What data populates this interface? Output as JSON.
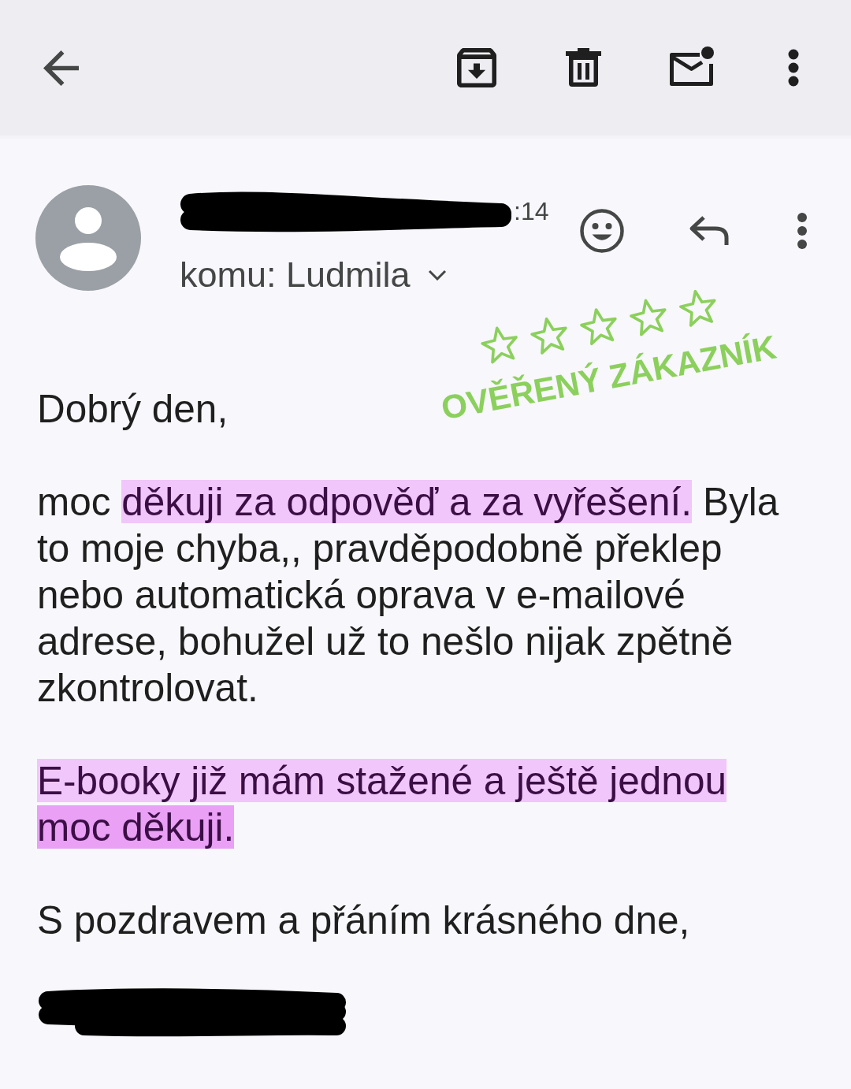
{
  "message_header": {
    "time": ":14",
    "recipient": "komu: Ludmila"
  },
  "badge": {
    "words": [
      "OVĚŘENÝ",
      "ZÁKAZNÍK"
    ]
  },
  "email_body": {
    "paragraphs": [
      {
        "segments": [
          {
            "text": "Dobrý den,",
            "highlighted": false
          }
        ]
      },
      {
        "segments": [
          {
            "text": "moc ",
            "highlighted": false
          },
          {
            "text": "děkuji za odpověď a za vyřešení.",
            "highlighted": true,
            "color": "#f1c6fa"
          },
          {
            "text": " Byla to moje chyba,, pravděpodobně překlep nebo automatická oprava v e-mailové adrese, bohužel už to nešlo nijak zpětně zkontrolovat.",
            "highlighted": false
          }
        ]
      },
      {
        "segments": [
          {
            "text": "E-booky již mám stažené a ještě jednou ",
            "highlighted": true,
            "color": "#f1c6fa"
          },
          {
            "text": "moc děkuji.",
            "highlighted": true,
            "color": "#e9a0f5"
          }
        ]
      },
      {
        "segments": [
          {
            "text": "S pozdravem a přáním krásného dne,",
            "highlighted": false
          }
        ]
      }
    ]
  }
}
